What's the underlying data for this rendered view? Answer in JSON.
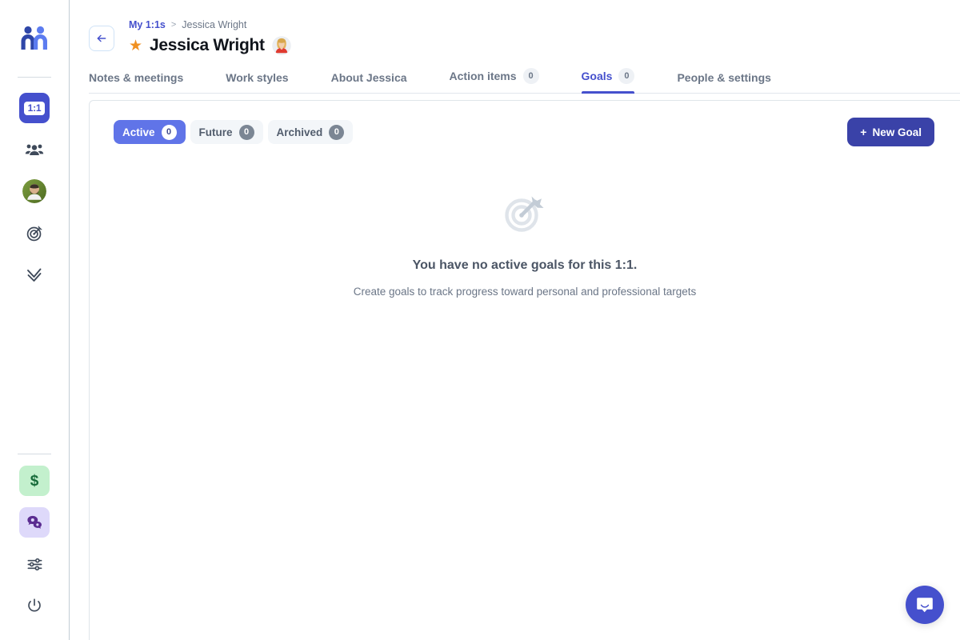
{
  "sidebar": {
    "logo_name": "mochary-logo",
    "top_items": [
      {
        "name": "one-on-one",
        "label": "1:1",
        "icon": "one-on-one-badge-icon",
        "state": "active"
      },
      {
        "name": "team",
        "label": "",
        "icon": "people-group-icon",
        "state": "default"
      },
      {
        "name": "profile",
        "label": "",
        "icon": "user-avatar-icon",
        "state": "default"
      },
      {
        "name": "goals",
        "label": "",
        "icon": "target-icon",
        "state": "default"
      },
      {
        "name": "tasks",
        "label": "",
        "icon": "double-check-icon",
        "state": "default"
      }
    ],
    "bottom_items": [
      {
        "name": "money",
        "label": "$",
        "icon": "dollar-icon",
        "state": "green"
      },
      {
        "name": "feedback",
        "label": "",
        "icon": "chat-bubbles-icon",
        "state": "purple"
      },
      {
        "name": "settings",
        "label": "",
        "icon": "sliders-icon",
        "state": "default"
      },
      {
        "name": "logout",
        "label": "",
        "icon": "power-icon",
        "state": "default"
      }
    ]
  },
  "header": {
    "back_label": "Back",
    "breadcrumb": {
      "root": "My 1:1s",
      "separator": ">",
      "current": "Jessica Wright"
    },
    "starred": true,
    "title": "Jessica Wright",
    "avatar_name": "jessica-wright-avatar"
  },
  "tabs": [
    {
      "label": "Notes & meetings",
      "count": null,
      "active": false
    },
    {
      "label": "Work styles",
      "count": null,
      "active": false
    },
    {
      "label": "About Jessica",
      "count": null,
      "active": false
    },
    {
      "label": "Action items",
      "count": "0",
      "active": false
    },
    {
      "label": "Goals",
      "count": "0",
      "active": true
    },
    {
      "label": "People & settings",
      "count": null,
      "active": false
    }
  ],
  "filters": {
    "pills": [
      {
        "label": "Active",
        "count": "0",
        "selected": true
      },
      {
        "label": "Future",
        "count": "0",
        "selected": false
      },
      {
        "label": "Archived",
        "count": "0",
        "selected": false
      }
    ],
    "new_goal_button": {
      "plus": "+",
      "label": "New Goal"
    }
  },
  "empty_state": {
    "icon": "target-dart-icon",
    "title": "You have no active goals for this 1:1.",
    "subtitle": "Create goals to track progress toward personal and professional targets"
  },
  "support": {
    "launcher_name": "intercom-chat-launcher"
  },
  "colors": {
    "accent_blue": "#4550cd",
    "pill_blue": "#6074e8",
    "button_blue": "#3a42a8",
    "star_orange": "#f09021",
    "money_green": "#c3f0cd",
    "chat_purple": "#ded9fa",
    "text_muted": "#6b7687"
  }
}
